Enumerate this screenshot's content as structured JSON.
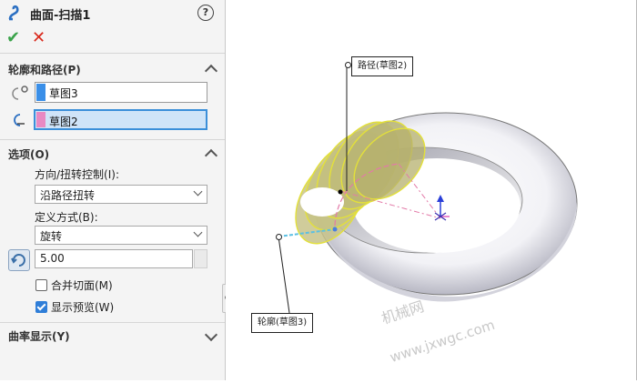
{
  "title": "曲面-扫描1",
  "profile_path": {
    "header": "轮廓和路径(P)",
    "profile_sketch": "草图3",
    "path_sketch": "草图2",
    "profile_color": "#3a8fe8",
    "path_color": "#e889c3"
  },
  "options": {
    "header": "选项(O)",
    "orientation_label": "方向/扭转控制(I):",
    "orientation_value": "沿路径扭转",
    "define_label": "定义方式(B):",
    "define_value": "旋转",
    "twist_value": "5.00",
    "merge_label": "合并切面(M)",
    "merge_checked": false,
    "preview_label": "显示预览(W)",
    "preview_checked": true
  },
  "curvature": {
    "header": "曲率显示(Y)"
  },
  "viewport": {
    "path_callout": "路径(草图2)",
    "profile_callout": "轮廓(草图3)",
    "watermark_1": "机械网",
    "watermark_2": "www.jxwgc.com"
  },
  "icons": [
    "sweep-surface-icon",
    "help-icon",
    "ok-check-icon",
    "cancel-x-icon",
    "profile-icon",
    "path-icon",
    "rotate-direction-icon"
  ]
}
